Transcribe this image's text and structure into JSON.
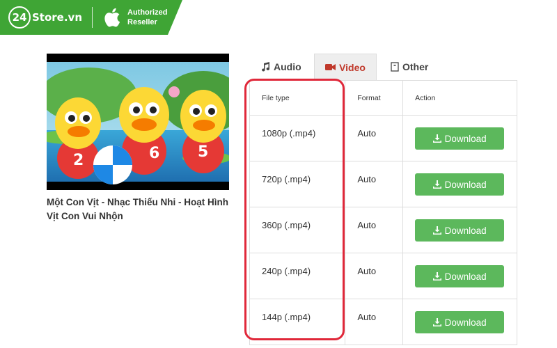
{
  "brand": {
    "number": "24",
    "name": "Store.vn",
    "authorized_line1": "Authorized",
    "authorized_line2": "Reseller",
    "accent": "#3fa535",
    "icons": [
      "apple-logo-icon"
    ]
  },
  "video": {
    "title": "Một Con Vịt - Nhạc Thiếu Nhi - Hoạt Hình Vịt Con Vui Nhộn",
    "thumbnail_numbers": [
      "2",
      "6",
      "5"
    ]
  },
  "tabs": [
    {
      "label": "Audio",
      "icon": "music-note-icon",
      "active": false
    },
    {
      "label": "Video",
      "icon": "video-camera-icon",
      "active": true
    },
    {
      "label": "Other",
      "icon": "file-icon",
      "active": false
    }
  ],
  "table": {
    "headers": [
      "File type",
      "Format",
      "Action"
    ],
    "rows": [
      {
        "file_type": "1080p (.mp4)",
        "format": "Auto",
        "action": "Download"
      },
      {
        "file_type": "720p (.mp4)",
        "format": "Auto",
        "action": "Download"
      },
      {
        "file_type": "360p (.mp4)",
        "format": "Auto",
        "action": "Download"
      },
      {
        "file_type": "240p (.mp4)",
        "format": "Auto",
        "action": "Download"
      },
      {
        "file_type": "144p (.mp4)",
        "format": "Auto",
        "action": "Download"
      }
    ]
  },
  "colors": {
    "download_button": "#5cb85c",
    "active_tab_text": "#c0392b",
    "highlight": "#e0283a"
  }
}
